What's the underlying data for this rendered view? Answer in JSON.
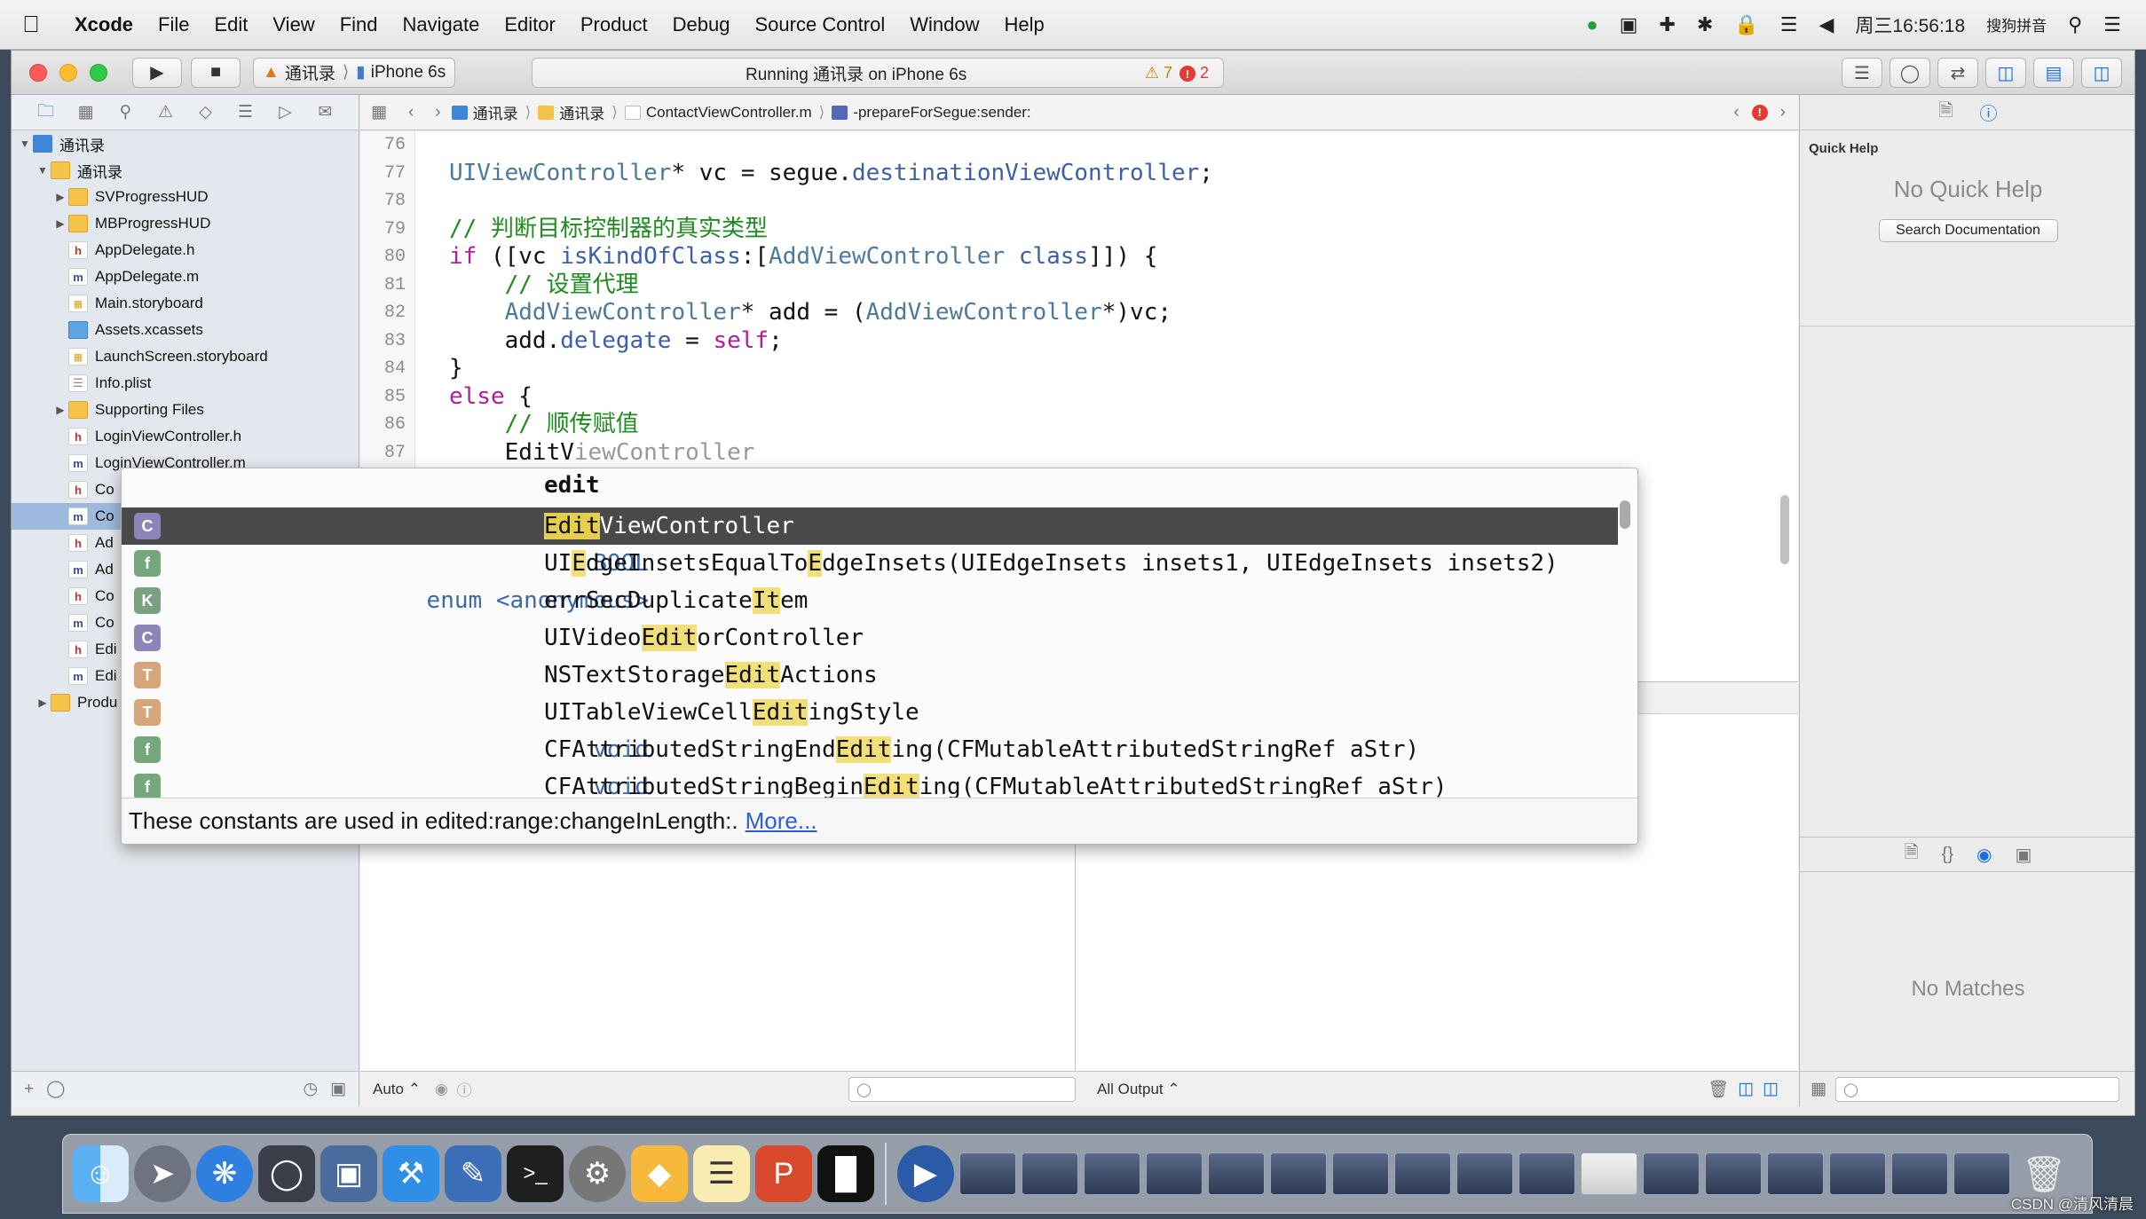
{
  "menubar": {
    "app": "Xcode",
    "items": [
      "File",
      "Edit",
      "View",
      "Find",
      "Navigate",
      "Editor",
      "Product",
      "Debug",
      "Source Control",
      "Window",
      "Help"
    ],
    "clock": "周三16:56:18",
    "input_method": "搜狗拼音"
  },
  "toolbar": {
    "scheme": "通讯录",
    "device": "iPhone 6s",
    "status": "Running 通讯录 on iPhone 6s",
    "warnings": "7",
    "errors": "2"
  },
  "jumpbar": {
    "crumbs": [
      "通讯录",
      "通讯录",
      "ContactViewController.m",
      "-prepareForSegue:sender:"
    ]
  },
  "navigator": {
    "items": [
      {
        "label": "通讯录",
        "type": "proj",
        "depth": 0,
        "disclosure": "▼"
      },
      {
        "label": "通讯录",
        "type": "folder",
        "depth": 1,
        "disclosure": "▼"
      },
      {
        "label": "SVProgressHUD",
        "type": "folder",
        "depth": 2,
        "disclosure": "▶"
      },
      {
        "label": "MBProgressHUD",
        "type": "folder",
        "depth": 2,
        "disclosure": "▶"
      },
      {
        "label": "AppDelegate.h",
        "type": "h",
        "depth": 2,
        "disclosure": ""
      },
      {
        "label": "AppDelegate.m",
        "type": "m",
        "depth": 2,
        "disclosure": ""
      },
      {
        "label": "Main.storyboard",
        "type": "sb",
        "depth": 2,
        "disclosure": ""
      },
      {
        "label": "Assets.xcassets",
        "type": "asset",
        "depth": 2,
        "disclosure": ""
      },
      {
        "label": "LaunchScreen.storyboard",
        "type": "sb",
        "depth": 2,
        "disclosure": ""
      },
      {
        "label": "Info.plist",
        "type": "plist",
        "depth": 2,
        "disclosure": ""
      },
      {
        "label": "Supporting Files",
        "type": "folder",
        "depth": 2,
        "disclosure": "▶"
      },
      {
        "label": "LoginViewController.h",
        "type": "h",
        "depth": 2,
        "disclosure": ""
      },
      {
        "label": "LoginViewController.m",
        "type": "m",
        "depth": 2,
        "disclosure": ""
      },
      {
        "label": "Co",
        "type": "h",
        "depth": 2,
        "disclosure": ""
      },
      {
        "label": "Co",
        "type": "m",
        "depth": 2,
        "disclosure": "",
        "selected": true
      },
      {
        "label": "Ad",
        "type": "h",
        "depth": 2,
        "disclosure": ""
      },
      {
        "label": "Ad",
        "type": "m",
        "depth": 2,
        "disclosure": ""
      },
      {
        "label": "Co",
        "type": "h",
        "depth": 2,
        "disclosure": ""
      },
      {
        "label": "Co",
        "type": "m",
        "depth": 2,
        "disclosure": ""
      },
      {
        "label": "Edi",
        "type": "h",
        "depth": 2,
        "disclosure": ""
      },
      {
        "label": "Edi",
        "type": "m",
        "depth": 2,
        "disclosure": ""
      },
      {
        "label": "Produ",
        "type": "folder",
        "depth": 1,
        "disclosure": "▶"
      }
    ]
  },
  "editor": {
    "line_numbers": [
      "76",
      "77",
      "78",
      "79",
      "80",
      "81",
      "82",
      "83",
      "84",
      "85",
      "86",
      "87"
    ],
    "lines": [
      [],
      [
        [
          "ty",
          "UIViewController"
        ],
        [
          "",
          "* vc = segue."
        ],
        [
          "mt",
          "destinationViewController"
        ],
        [
          "",
          ";"
        ]
      ],
      [],
      [
        [
          "cm",
          "// 判断目标控制器的真实类型"
        ]
      ],
      [
        [
          "kw",
          "if"
        ],
        [
          "",
          " ([vc "
        ],
        [
          "mt",
          "isKindOfClass"
        ],
        [
          "",
          ":["
        ],
        [
          "ty",
          "AddViewController"
        ],
        [
          "",
          " "
        ],
        [
          "mt",
          "class"
        ],
        [
          "",
          "]]) {"
        ]
      ],
      [
        [
          "",
          "    "
        ],
        [
          "cm",
          "// 设置代理"
        ]
      ],
      [
        [
          "",
          "    "
        ],
        [
          "ty",
          "AddViewController"
        ],
        [
          "",
          "* add = ("
        ],
        [
          "ty",
          "AddViewController"
        ],
        [
          "",
          "*)vc;"
        ]
      ],
      [
        [
          "",
          "    add."
        ],
        [
          "mt",
          "delegate"
        ],
        [
          "",
          " = "
        ],
        [
          "kw",
          "self"
        ],
        [
          "",
          ";"
        ]
      ],
      [
        [
          "",
          "}"
        ]
      ],
      [
        [
          "kw",
          "else"
        ],
        [
          "",
          " {"
        ]
      ],
      [
        [
          "",
          "    "
        ],
        [
          "cm",
          "// 顺传赋值"
        ]
      ],
      [
        [
          "",
          "    EditV"
        ],
        [
          "ghost",
          "iewController"
        ]
      ]
    ]
  },
  "completion": {
    "typed": "edit",
    "items": [
      {
        "kind": "C",
        "rtype": "",
        "parts": [
          [
            "h",
            "Edit"
          ],
          [
            "",
            "ViewController"
          ]
        ],
        "selected": true
      },
      {
        "kind": "f",
        "rtype": "BOOL",
        "parts": [
          [
            "",
            "UI"
          ],
          [
            "h",
            "E"
          ],
          [
            "",
            "dgeInsetsEqualTo"
          ],
          [
            "h",
            "E"
          ],
          [
            "",
            "dgeInsets(UIEdgeInsets insets1, UIEdgeInsets insets2)"
          ]
        ]
      },
      {
        "kind": "K",
        "rtype": "enum <anonymous>",
        "parts": [
          [
            "",
            "errSecDuplicate"
          ],
          [
            "h",
            "It"
          ],
          [
            "",
            "em"
          ]
        ]
      },
      {
        "kind": "C",
        "rtype": "",
        "parts": [
          [
            "",
            "UIVideo"
          ],
          [
            "h",
            "Edit"
          ],
          [
            "",
            "orController"
          ]
        ]
      },
      {
        "kind": "T",
        "rtype": "",
        "parts": [
          [
            "",
            "NSTextStorage"
          ],
          [
            "h",
            "Edit"
          ],
          [
            "",
            "Actions"
          ]
        ]
      },
      {
        "kind": "T",
        "rtype": "",
        "parts": [
          [
            "",
            "UITableViewCell"
          ],
          [
            "h",
            "Edit"
          ],
          [
            "",
            "ingStyle"
          ]
        ]
      },
      {
        "kind": "f",
        "rtype": "void",
        "parts": [
          [
            "",
            "CFAttributedStringEnd"
          ],
          [
            "h",
            "Edit"
          ],
          [
            "",
            "ing(CFMutableAttributedStringRef aStr)"
          ]
        ]
      },
      {
        "kind": "f",
        "rtype": "void",
        "parts": [
          [
            "",
            "CFAttributedStringBegin"
          ],
          [
            "h",
            "Edit"
          ],
          [
            "",
            "ing(CFMutableAttributedStringRef aStr)"
          ]
        ]
      }
    ],
    "footer_text": "These constants are used in edited:range:changeInLength:.",
    "footer_link": "More..."
  },
  "debug": {
    "auto_label": "Auto ⌃",
    "output_label": "All Output ⌃"
  },
  "utilities": {
    "quick_help_title": "Quick Help",
    "no_quick_help": "No Quick Help",
    "search_docs": "Search Documentation",
    "no_matches": "No Matches"
  },
  "watermark": "CSDN @清风清晨",
  "colors": {
    "keyword": "#b01e9c",
    "type": "#4d7a9b",
    "comment": "#1f8c1f",
    "selection": "#4a4a4a",
    "highlight": "#f2df7a"
  }
}
